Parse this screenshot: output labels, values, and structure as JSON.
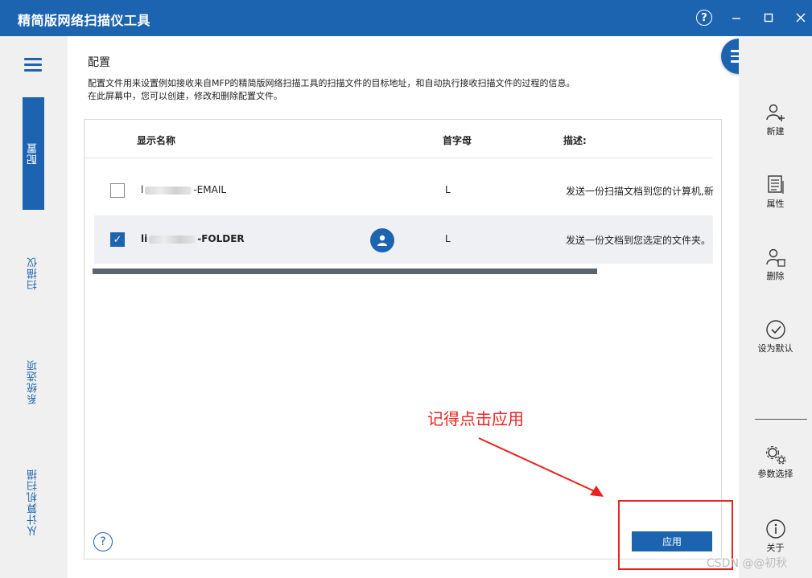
{
  "window": {
    "title": "精简版网络扫描仪工具"
  },
  "left_nav": {
    "tabs": [
      {
        "label": "配置"
      },
      {
        "label": "扫描仪"
      },
      {
        "label": "系统选项"
      },
      {
        "label": "从计算机扫描"
      }
    ]
  },
  "main": {
    "title": "配置",
    "description_line1": "配置文件用来设置例如接收来自MFP的精简版网络扫描工具的扫描文件的目标地址，和自动执行接收扫描文件的过程的信息。",
    "description_line2": "在此屏幕中，您可以创建，修改和删除配置文件。",
    "table": {
      "headers": {
        "name": "显示名称",
        "initial": "首字母",
        "desc": "描述:"
      },
      "rows": [
        {
          "name_prefix": "l",
          "name_suffix": "-EMAIL",
          "initial": "L",
          "desc": "发送一份扫描文档到您的计算机,新",
          "checked": false
        },
        {
          "name_prefix": "li",
          "name_suffix": "-FOLDER",
          "initial": "L",
          "desc": "发送一份文档到您选定的文件夹。",
          "checked": true
        }
      ]
    },
    "help_glyph": "?",
    "apply_label": "应用"
  },
  "annotation": {
    "text": "记得点击应用"
  },
  "right_toolbar": {
    "new_label": "新建",
    "properties_label": "属性",
    "delete_label": "删除",
    "set_default_label": "设为默认",
    "params_label": "参数选择",
    "about_label": "关于"
  },
  "watermark": "CSDN @@初秋",
  "colors": {
    "brand": "#1d64b0",
    "annotation": "#e8231f"
  }
}
